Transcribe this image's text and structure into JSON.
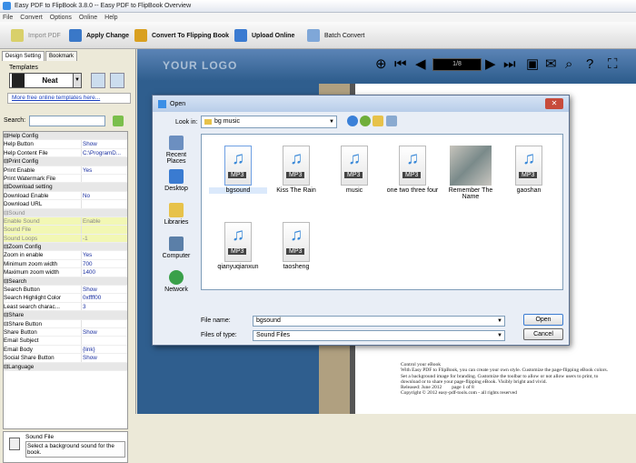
{
  "window": {
    "title": "Easy PDF to FlipBook 3.8.0  -- Easy PDF to FlipBook Overview"
  },
  "menu": [
    "File",
    "Convert",
    "Options",
    "Online",
    "Help"
  ],
  "toolbar": {
    "import": "Import PDF",
    "apply": "Apply Change",
    "convert": "Convert To Flipping Book",
    "upload": "Upload Online",
    "batch": "Batch Convert"
  },
  "tabs": {
    "design": "Design Setting",
    "bookmark": "Bookmark"
  },
  "templates": {
    "label": "Templates",
    "name": "Neat",
    "more": "More free online templates here..."
  },
  "search": {
    "label": "Search:"
  },
  "props": [
    {
      "k": "⊟Help Config",
      "cat": true
    },
    {
      "k": "    Help Button",
      "v": "Show"
    },
    {
      "k": "    Help Content File",
      "v": "C:\\ProgramD..."
    },
    {
      "k": "⊟Print Config",
      "cat": true
    },
    {
      "k": "    Print Enable",
      "v": "Yes"
    },
    {
      "k": "    Print Watermark File",
      "v": ""
    },
    {
      "k": "⊟Download setting",
      "cat": true
    },
    {
      "k": "    Download Enable",
      "v": "No"
    },
    {
      "k": "    Download URL",
      "v": ""
    },
    {
      "k": "⊟Sound",
      "cat": true,
      "hl": true
    },
    {
      "k": "    Enable Sound",
      "v": "Enable",
      "hl": true
    },
    {
      "k": "    Sound File",
      "v": "",
      "hl": true
    },
    {
      "k": "    Sound Loops",
      "v": "-1",
      "hl": true
    },
    {
      "k": "⊟Zoom Config",
      "cat": true
    },
    {
      "k": "    Zoom in enable",
      "v": "Yes"
    },
    {
      "k": "    Minimum zoom width",
      "v": "700"
    },
    {
      "k": "    Maximum zoom width",
      "v": "1400"
    },
    {
      "k": "⊟Search",
      "cat": true
    },
    {
      "k": "    Search Button",
      "v": "Show"
    },
    {
      "k": "    Search Highlight Color",
      "v": "0xffff00"
    },
    {
      "k": "    Least search charac...",
      "v": "3"
    },
    {
      "k": "⊟Share",
      "cat": true
    },
    {
      "k": "  ⊟Share Button",
      "v": ""
    },
    {
      "k": "      Share Button",
      "v": "Show"
    },
    {
      "k": "      Email Subject",
      "v": ""
    },
    {
      "k": "      Email Body",
      "v": "{link}"
    },
    {
      "k": "    Social Share Button",
      "v": "Show"
    },
    {
      "k": "⊟Language",
      "cat": true
    }
  ],
  "help": {
    "title": "Sound File",
    "desc": "Select a background sound for the book."
  },
  "viewer": {
    "logo": "YOUR LOGO",
    "page": "1/8"
  },
  "book": {
    "caption": "Control your eBook\nWith Easy PDF to FlipBook, you can create your own style. Customize the page-flipping eBook colors.\nSet a background image for branding. Customize the toolbar to allow or not allow users to print, to download or to share your page-flipping eBook. Visibly bright and vivid.\nReleased: June 2012        page 1 of 8\nCopyright © 2012 easy-pdf-tools.com - all rights reserved"
  },
  "dialog": {
    "title": "Open",
    "lookin_label": "Look in:",
    "lookin_value": "bg music",
    "places": [
      "Recent Places",
      "Desktop",
      "Libraries",
      "Computer",
      "Network"
    ],
    "files": [
      {
        "name": "bgsound",
        "selected": true
      },
      {
        "name": "Kiss The Rain"
      },
      {
        "name": "music"
      },
      {
        "name": "one two three four"
      },
      {
        "name": "Remember The Name",
        "photo": true
      },
      {
        "name": "gaoshan"
      },
      {
        "name": "qianyuqianxun"
      },
      {
        "name": "taosheng"
      }
    ],
    "filename_label": "File name:",
    "filename_value": "bgsound",
    "filetype_label": "Files of type:",
    "filetype_value": "Sound Files",
    "open": "Open",
    "cancel": "Cancel"
  }
}
